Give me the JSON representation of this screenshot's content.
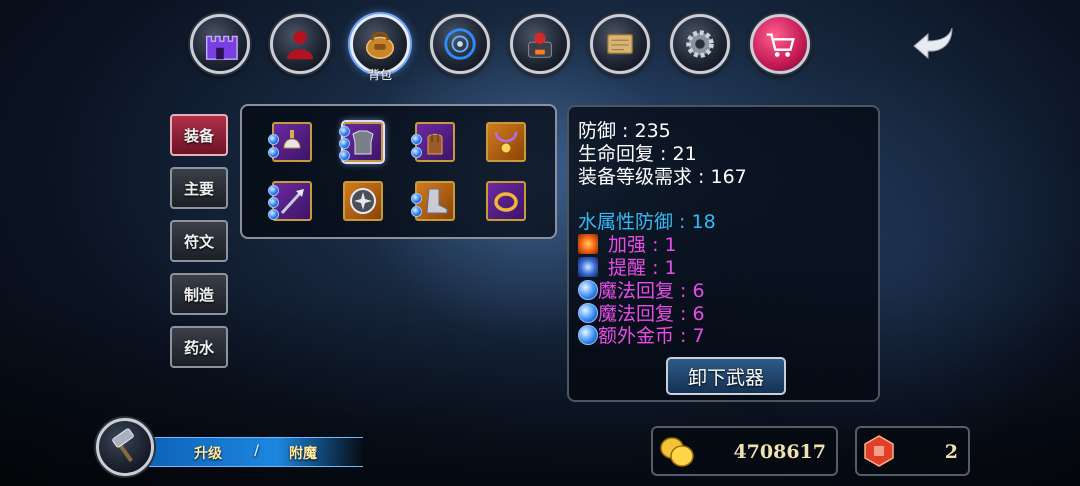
{
  "nav": {
    "items": [
      {
        "icon": "castle-icon"
      },
      {
        "icon": "character-icon"
      },
      {
        "icon": "backpack-icon",
        "label": "背包",
        "active": true
      },
      {
        "icon": "rune-circle-icon"
      },
      {
        "icon": "forge-icon"
      },
      {
        "icon": "scroll-map-icon"
      },
      {
        "icon": "gear-icon"
      },
      {
        "icon": "shopping-cart-icon"
      }
    ],
    "back_icon": "back-arrow-icon"
  },
  "tabs": [
    {
      "label": "装备",
      "active": true
    },
    {
      "label": "主要"
    },
    {
      "label": "符文"
    },
    {
      "label": "制造"
    },
    {
      "label": "药水"
    }
  ],
  "inventory": {
    "items": [
      {
        "icon": "helmet-icon",
        "rarity": "purple",
        "gems": 2
      },
      {
        "icon": "armor-icon",
        "rarity": "purple",
        "gems": 3,
        "selected": true
      },
      {
        "icon": "gauntlet-icon",
        "rarity": "purple",
        "gems": 2
      },
      {
        "icon": "amulet-icon",
        "rarity": "orange",
        "gems": 0
      },
      {
        "icon": "weapon-icon",
        "rarity": "purple",
        "gems": 3
      },
      {
        "icon": "shield-emblem-icon",
        "rarity": "orange",
        "gems": 0
      },
      {
        "icon": "boots-icon",
        "rarity": "orange",
        "gems": 2
      },
      {
        "icon": "ring-icon",
        "rarity": "purple",
        "gems": 0
      }
    ]
  },
  "stats": {
    "base": [
      "防御 : 235",
      "生命回复 : 21",
      "装备等级需求 : 167"
    ],
    "element": "水属性防御 : 18",
    "enchants": [
      {
        "icon": "fire-burst-icon",
        "text": " 加强 : 1"
      },
      {
        "icon": "ice-sparkle-icon",
        "text": " 提醒 : 1"
      }
    ],
    "gems": [
      {
        "icon": "blue-orb-icon",
        "text": "魔法回复 : 6"
      },
      {
        "icon": "blue-orb-icon",
        "text": "魔法回复 : 6"
      },
      {
        "icon": "blue-orb-icon",
        "text": "额外金币 : 7"
      }
    ],
    "unequip_label": "卸下武器"
  },
  "bottom": {
    "hammer_icon": "hammer-icon",
    "upgrade_label": "升级",
    "separator": "/",
    "enchant_label": "附魔",
    "gold": {
      "icon": "gold-coins-icon",
      "value": "4708617"
    },
    "gems": {
      "icon": "red-gem-icon",
      "value": "2"
    }
  },
  "colors": {
    "stat_white": "#ffffff",
    "stat_element": "#35b9f4",
    "stat_bonus": "#e84ce8",
    "active_tab": "#b0304a",
    "upgrade_bar": "#1d87e0"
  }
}
